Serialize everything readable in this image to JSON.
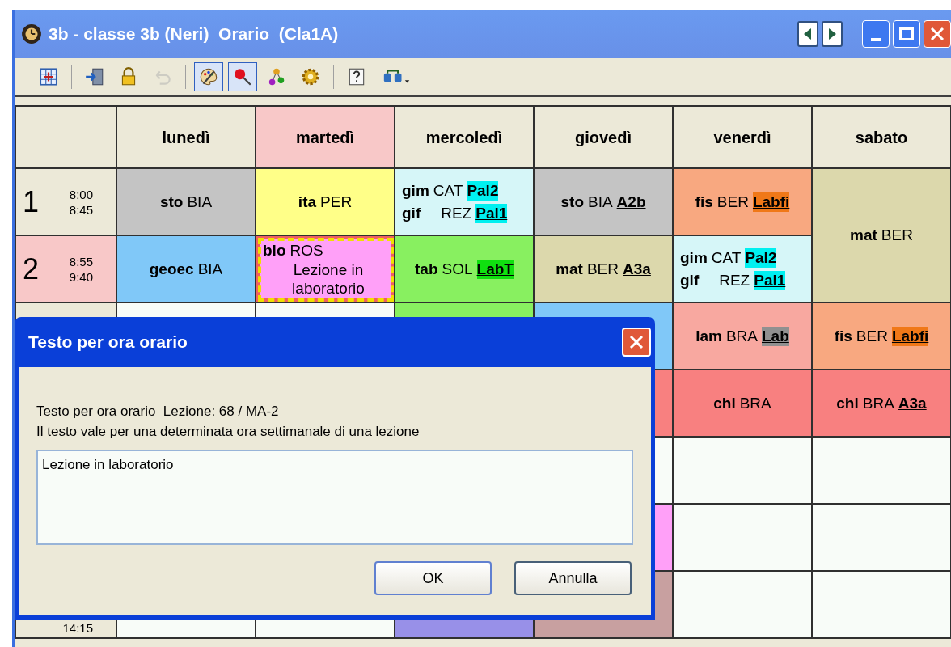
{
  "window": {
    "title": "3b - classe 3b (Neri)  Orario  (Cla1A)"
  },
  "toolbar": [
    {
      "kind": "grid",
      "pressed": false,
      "disabled": false
    },
    {
      "kind": "separator"
    },
    {
      "kind": "exit",
      "pressed": false,
      "disabled": false
    },
    {
      "kind": "lock",
      "pressed": false,
      "disabled": false
    },
    {
      "kind": "undo",
      "pressed": false,
      "disabled": true
    },
    {
      "kind": "separator"
    },
    {
      "kind": "palette",
      "pressed": true,
      "disabled": false
    },
    {
      "kind": "pin",
      "pressed": true,
      "disabled": false
    },
    {
      "kind": "nodes",
      "pressed": false,
      "disabled": false
    },
    {
      "kind": "gear",
      "pressed": false,
      "disabled": false
    },
    {
      "kind": "separator"
    },
    {
      "kind": "help",
      "pressed": false,
      "disabled": false
    },
    {
      "kind": "link",
      "pressed": false,
      "disabled": false
    }
  ],
  "timetable": {
    "days": [
      {
        "label": "lunedì",
        "selected": false
      },
      {
        "label": "martedì",
        "selected": true
      },
      {
        "label": "mercoledì",
        "selected": false
      },
      {
        "label": "giovedì",
        "selected": false
      },
      {
        "label": "venerdì",
        "selected": false
      },
      {
        "label": "sabato",
        "selected": false
      }
    ],
    "rows": [
      {
        "number": "1",
        "start": "8:00",
        "end": "8:45",
        "selected": false,
        "cells": [
          {
            "kind": "lesson",
            "color": "#c4c4c4",
            "selected": false,
            "lines": [
              {
                "subject": "sto",
                "teacher": "BIA"
              }
            ]
          },
          {
            "kind": "lesson",
            "color": "#ffff88",
            "selected": false,
            "lines": [
              {
                "subject": "ita",
                "teacher": "PER"
              }
            ]
          },
          {
            "kind": "lesson",
            "color": "#d6f6f8",
            "selected": false,
            "lines": [
              {
                "subject": "gim",
                "teacher": "CAT",
                "room": {
                  "label": "Pal2",
                  "color": "#00f0f0"
                }
              },
              {
                "subject": "gif",
                "teacher": "REZ",
                "room": {
                  "label": "Pal1",
                  "color": "#00f0f0"
                }
              }
            ]
          },
          {
            "kind": "lesson",
            "color": "#c4c4c4",
            "selected": false,
            "lines": [
              {
                "subject": "sto",
                "teacher": "BIA",
                "room": {
                  "label": "A2b"
                }
              }
            ]
          },
          {
            "kind": "lesson",
            "color": "#f8a880",
            "selected": false,
            "lines": [
              {
                "subject": "fis",
                "teacher": "BER",
                "room": {
                  "label": "Labfi",
                  "color": "#f07818"
                }
              }
            ]
          },
          {
            "kind": "double_lesson",
            "color": "#dcd8ac",
            "selected": false,
            "lines": [
              {
                "subject": "mat",
                "teacher": "BER"
              }
            ]
          }
        ]
      },
      {
        "number": "2",
        "start": "8:55",
        "end": "9:40",
        "selected": true,
        "cells": [
          {
            "kind": "lesson",
            "color": "#80c8f8",
            "selected": false,
            "lines": [
              {
                "subject": "geoec",
                "teacher": "BIA"
              }
            ]
          },
          {
            "kind": "lesson",
            "color": "#ffa0f8",
            "selected": true,
            "lines": [
              {
                "subject": "bio",
                "teacher": "ROS"
              }
            ],
            "note": "Lezione in laboratorio"
          },
          {
            "kind": "lesson",
            "color": "#88f060",
            "selected": false,
            "lines": [
              {
                "subject": "tab",
                "teacher": "SOL",
                "room": {
                  "label": "LabT",
                  "color": "#10e010"
                }
              }
            ]
          },
          {
            "kind": "lesson",
            "color": "#dcd8ac",
            "selected": false,
            "lines": [
              {
                "subject": "mat",
                "teacher": "BER",
                "room": {
                  "label": "A3a"
                }
              }
            ]
          },
          {
            "kind": "lesson",
            "color": "#d6f6f8",
            "selected": false,
            "lines": [
              {
                "subject": "gim",
                "teacher": "CAT",
                "room": {
                  "label": "Pal2",
                  "color": "#00f0f0"
                }
              },
              {
                "subject": "gif",
                "teacher": "REZ",
                "room": {
                  "label": "Pal1",
                  "color": "#00f0f0"
                }
              }
            ]
          }
        ]
      },
      {
        "cells": [
          {
            "kind": "hidden"
          },
          {
            "kind": "hidden"
          },
          {
            "kind": "hidden",
            "color": "#88f060"
          },
          {
            "kind": "hidden",
            "color": "#80c8f8"
          },
          {
            "kind": "lesson",
            "color": "#f8a8a0",
            "selected": false,
            "lines": [
              {
                "subject": "lam",
                "teacher": "BRA",
                "room": {
                  "label": "Lab",
                  "color": "#909090"
                }
              }
            ]
          },
          {
            "kind": "lesson",
            "color": "#f8a880",
            "selected": false,
            "lines": [
              {
                "subject": "fis",
                "teacher": "BER",
                "room": {
                  "label": "Labfi",
                  "color": "#f07818"
                }
              }
            ]
          }
        ]
      },
      {
        "cells": [
          {
            "kind": "hidden"
          },
          {
            "kind": "hidden"
          },
          {
            "kind": "hidden"
          },
          {
            "kind": "hidden",
            "color": "#f88080"
          },
          {
            "kind": "lesson",
            "color": "#f88080",
            "selected": false,
            "lines": [
              {
                "subject": "chi",
                "teacher": "BRA"
              }
            ]
          },
          {
            "kind": "lesson",
            "color": "#f88080",
            "selected": false,
            "lines": [
              {
                "subject": "chi",
                "teacher": "BRA",
                "room": {
                  "label": "A3a"
                }
              }
            ]
          }
        ]
      },
      {
        "cells": [
          {
            "kind": "hidden"
          },
          {
            "kind": "hidden"
          },
          {
            "kind": "hidden"
          },
          {
            "kind": "hidden"
          },
          {
            "kind": "empty"
          },
          {
            "kind": "empty"
          }
        ]
      },
      {
        "cells": [
          {
            "kind": "hidden"
          },
          {
            "kind": "hidden"
          },
          {
            "kind": "hidden"
          },
          {
            "kind": "hidden",
            "color": "#ffa0f8"
          },
          {
            "kind": "empty"
          },
          {
            "kind": "empty"
          }
        ]
      },
      {
        "end": "14:15",
        "selected": false,
        "cells": [
          {
            "kind": "empty"
          },
          {
            "kind": "empty"
          },
          {
            "kind": "hidden",
            "color": "#9890e8"
          },
          {
            "kind": "hidden",
            "color": "#c8a0a0"
          },
          {
            "kind": "empty"
          },
          {
            "kind": "empty"
          }
        ]
      }
    ]
  },
  "dialog": {
    "title": "Testo per ora orario",
    "info": [
      "Testo per ora orario  Lezione: 68 / MA-2",
      "Il testo vale per una determinata ora settimanale di una lezione"
    ],
    "text": "Lezione in laboratorio",
    "buttons": [
      {
        "label": "OK",
        "default": true
      },
      {
        "label": "Annulla",
        "default": false
      }
    ]
  }
}
